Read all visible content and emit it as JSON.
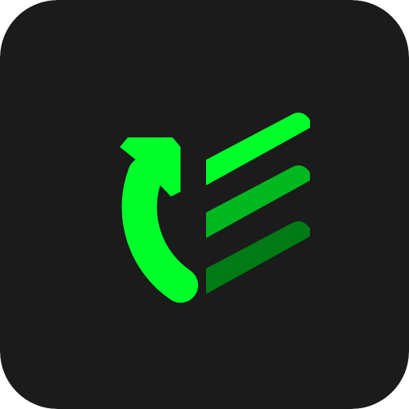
{
  "icon": {
    "name": "app-icon",
    "symbol": "refresh-arrow-with-stacked-bars",
    "colors": {
      "background": "#1b1b1b",
      "arrow": "#00ff2a",
      "bar_top": "#00ff2a",
      "bar_middle": "#00b81f",
      "bar_bottom": "#007a15"
    }
  }
}
